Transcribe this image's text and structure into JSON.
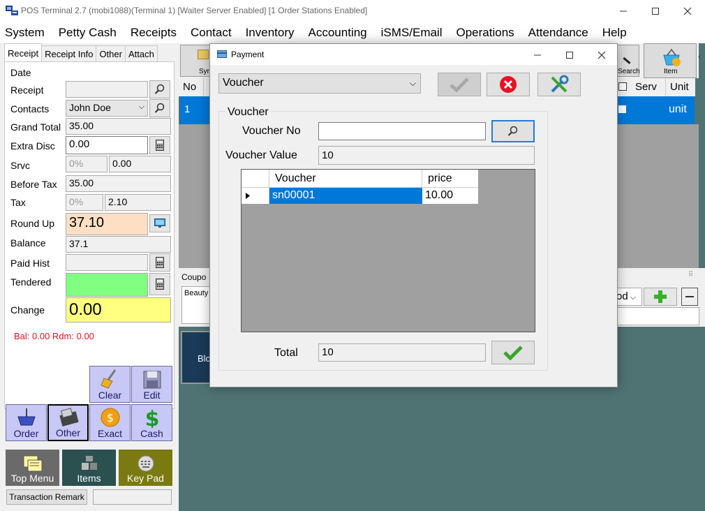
{
  "window": {
    "title": "POS Terminal 2.7 (mobi1088)(Terminal 1) [Waiter Server Enabled] [1 Order Stations Enabled]"
  },
  "menu": [
    "System",
    "Petty Cash",
    "Receipts",
    "Contact",
    "Inventory",
    "Accounting",
    "iSMS/Email",
    "Operations",
    "Attendance",
    "Help"
  ],
  "left_tabs": [
    "Receipt",
    "Receipt Info",
    "Other",
    "Attach"
  ],
  "receipt": {
    "date_label": "Date",
    "receipt_label": "Receipt",
    "contacts_label": "Contacts",
    "contacts_value": "John Doe",
    "grand_total_label": "Grand Total",
    "grand_total_value": "35.00",
    "extra_disc_label": "Extra Disc",
    "extra_disc_value": "0.00",
    "srvc_label": "Srvc",
    "srvc_pct": "0%",
    "srvc_value": "0.00",
    "before_tax_label": "Before Tax",
    "before_tax_value": "35.00",
    "tax_label": "Tax",
    "tax_pct": "0%",
    "tax_value": "2.10",
    "round_up_label": "Round Up",
    "round_up_value": "37.10",
    "balance_label": "Balance",
    "balance_value": "37.1",
    "paid_hist_label": "Paid Hist",
    "tendered_label": "Tendered",
    "change_label": "Change",
    "change_value": "0.00",
    "bal_rdm": "Bal: 0.00 Rdm: 0.00"
  },
  "action_buttons": {
    "clear": "Clear",
    "edit": "Edit",
    "order": "Order",
    "other": "Other",
    "exact": "Exact",
    "cash": "Cash"
  },
  "bottom_buttons": {
    "top_menu": "Top Menu",
    "items": "Items",
    "key_pad": "Key Pad",
    "transaction_remark": "Transaction Remark"
  },
  "main": {
    "toolbar_partial": "Syn",
    "search_label": "Search",
    "item_label": "Item",
    "grid_headers": {
      "no": "No",
      "serv": "Serv",
      "unit": "Unit"
    },
    "grid_row": {
      "no": "1",
      "unit": "unit"
    },
    "coupon_label": "Coupo",
    "beauty_label": "Beauty",
    "dropdown_partial": "od",
    "tile_partial": "Blo"
  },
  "dialog": {
    "title": "Payment",
    "payment_type": "Voucher",
    "group_label": "Voucher",
    "voucher_no_label": "Voucher No",
    "voucher_no_value": "",
    "voucher_value_label": "Voucher Value",
    "voucher_value": "10",
    "grid_columns": [
      "Voucher",
      "price"
    ],
    "grid_rows": [
      {
        "voucher": "sn00001",
        "price": "10.00"
      }
    ],
    "total_label": "Total",
    "total_value": "10"
  },
  "colors": {
    "selection": "#0078d7",
    "main_bg": "#4f7373",
    "round_up_bg": "#ffdfc4",
    "tendered_bg": "#80ff80",
    "change_bg": "#ffff80",
    "accent_red": "#e81123",
    "ok_green": "#3aa52a"
  }
}
